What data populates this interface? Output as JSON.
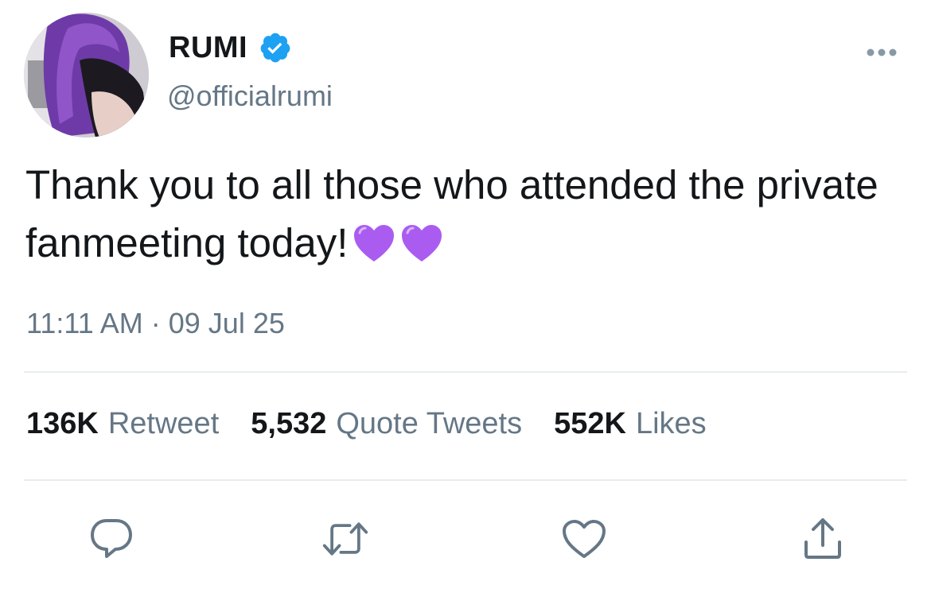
{
  "user": {
    "display_name": "RUMI",
    "handle": "@officialrumi",
    "verified": true,
    "avatar_icon": "profile-photo-purple-hair"
  },
  "tweet": {
    "text": "Thank you to all those who attended the private fanmeeting today!",
    "emoji": [
      "purple-heart",
      "purple-heart"
    ],
    "timestamp": "11:11 AM · 09 Jul 25"
  },
  "stats": {
    "retweets_count": "136K",
    "retweets_label": "Retweet",
    "quotes_count": "5,532",
    "quotes_label": "Quote Tweets",
    "likes_count": "552K",
    "likes_label": "Likes"
  },
  "actions": [
    "reply-icon",
    "retweet-icon",
    "like-icon",
    "share-icon"
  ],
  "colors": {
    "text": "#14171a",
    "secondary": "#657786",
    "verified_blue": "#1da1f2",
    "divider": "#e6ecf0",
    "heart_purple": "#aa5cf0"
  }
}
